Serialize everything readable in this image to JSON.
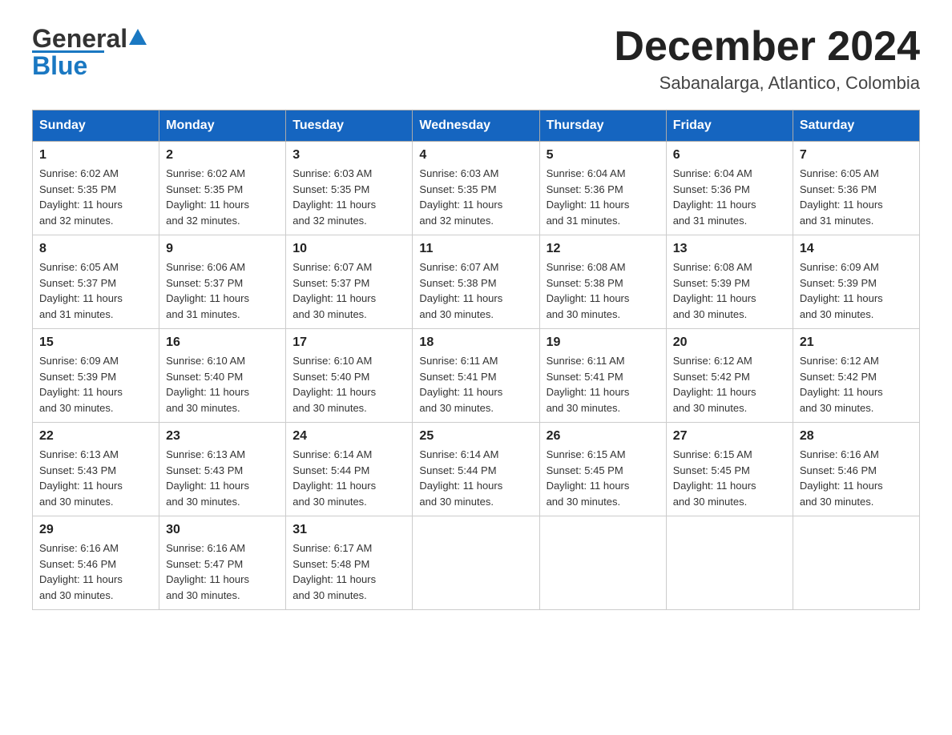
{
  "header": {
    "logo_general": "General",
    "logo_blue": "Blue",
    "month_title": "December 2024",
    "location": "Sabanalarga, Atlantico, Colombia"
  },
  "days_of_week": [
    "Sunday",
    "Monday",
    "Tuesday",
    "Wednesday",
    "Thursday",
    "Friday",
    "Saturday"
  ],
  "weeks": [
    [
      {
        "day": "1",
        "sunrise": "6:02 AM",
        "sunset": "5:35 PM",
        "daylight": "11 hours and 32 minutes."
      },
      {
        "day": "2",
        "sunrise": "6:02 AM",
        "sunset": "5:35 PM",
        "daylight": "11 hours and 32 minutes."
      },
      {
        "day": "3",
        "sunrise": "6:03 AM",
        "sunset": "5:35 PM",
        "daylight": "11 hours and 32 minutes."
      },
      {
        "day": "4",
        "sunrise": "6:03 AM",
        "sunset": "5:35 PM",
        "daylight": "11 hours and 32 minutes."
      },
      {
        "day": "5",
        "sunrise": "6:04 AM",
        "sunset": "5:36 PM",
        "daylight": "11 hours and 31 minutes."
      },
      {
        "day": "6",
        "sunrise": "6:04 AM",
        "sunset": "5:36 PM",
        "daylight": "11 hours and 31 minutes."
      },
      {
        "day": "7",
        "sunrise": "6:05 AM",
        "sunset": "5:36 PM",
        "daylight": "11 hours and 31 minutes."
      }
    ],
    [
      {
        "day": "8",
        "sunrise": "6:05 AM",
        "sunset": "5:37 PM",
        "daylight": "11 hours and 31 minutes."
      },
      {
        "day": "9",
        "sunrise": "6:06 AM",
        "sunset": "5:37 PM",
        "daylight": "11 hours and 31 minutes."
      },
      {
        "day": "10",
        "sunrise": "6:07 AM",
        "sunset": "5:37 PM",
        "daylight": "11 hours and 30 minutes."
      },
      {
        "day": "11",
        "sunrise": "6:07 AM",
        "sunset": "5:38 PM",
        "daylight": "11 hours and 30 minutes."
      },
      {
        "day": "12",
        "sunrise": "6:08 AM",
        "sunset": "5:38 PM",
        "daylight": "11 hours and 30 minutes."
      },
      {
        "day": "13",
        "sunrise": "6:08 AM",
        "sunset": "5:39 PM",
        "daylight": "11 hours and 30 minutes."
      },
      {
        "day": "14",
        "sunrise": "6:09 AM",
        "sunset": "5:39 PM",
        "daylight": "11 hours and 30 minutes."
      }
    ],
    [
      {
        "day": "15",
        "sunrise": "6:09 AM",
        "sunset": "5:39 PM",
        "daylight": "11 hours and 30 minutes."
      },
      {
        "day": "16",
        "sunrise": "6:10 AM",
        "sunset": "5:40 PM",
        "daylight": "11 hours and 30 minutes."
      },
      {
        "day": "17",
        "sunrise": "6:10 AM",
        "sunset": "5:40 PM",
        "daylight": "11 hours and 30 minutes."
      },
      {
        "day": "18",
        "sunrise": "6:11 AM",
        "sunset": "5:41 PM",
        "daylight": "11 hours and 30 minutes."
      },
      {
        "day": "19",
        "sunrise": "6:11 AM",
        "sunset": "5:41 PM",
        "daylight": "11 hours and 30 minutes."
      },
      {
        "day": "20",
        "sunrise": "6:12 AM",
        "sunset": "5:42 PM",
        "daylight": "11 hours and 30 minutes."
      },
      {
        "day": "21",
        "sunrise": "6:12 AM",
        "sunset": "5:42 PM",
        "daylight": "11 hours and 30 minutes."
      }
    ],
    [
      {
        "day": "22",
        "sunrise": "6:13 AM",
        "sunset": "5:43 PM",
        "daylight": "11 hours and 30 minutes."
      },
      {
        "day": "23",
        "sunrise": "6:13 AM",
        "sunset": "5:43 PM",
        "daylight": "11 hours and 30 minutes."
      },
      {
        "day": "24",
        "sunrise": "6:14 AM",
        "sunset": "5:44 PM",
        "daylight": "11 hours and 30 minutes."
      },
      {
        "day": "25",
        "sunrise": "6:14 AM",
        "sunset": "5:44 PM",
        "daylight": "11 hours and 30 minutes."
      },
      {
        "day": "26",
        "sunrise": "6:15 AM",
        "sunset": "5:45 PM",
        "daylight": "11 hours and 30 minutes."
      },
      {
        "day": "27",
        "sunrise": "6:15 AM",
        "sunset": "5:45 PM",
        "daylight": "11 hours and 30 minutes."
      },
      {
        "day": "28",
        "sunrise": "6:16 AM",
        "sunset": "5:46 PM",
        "daylight": "11 hours and 30 minutes."
      }
    ],
    [
      {
        "day": "29",
        "sunrise": "6:16 AM",
        "sunset": "5:46 PM",
        "daylight": "11 hours and 30 minutes."
      },
      {
        "day": "30",
        "sunrise": "6:16 AM",
        "sunset": "5:47 PM",
        "daylight": "11 hours and 30 minutes."
      },
      {
        "day": "31",
        "sunrise": "6:17 AM",
        "sunset": "5:48 PM",
        "daylight": "11 hours and 30 minutes."
      },
      null,
      null,
      null,
      null
    ]
  ],
  "labels": {
    "sunrise": "Sunrise:",
    "sunset": "Sunset:",
    "daylight": "Daylight:"
  }
}
